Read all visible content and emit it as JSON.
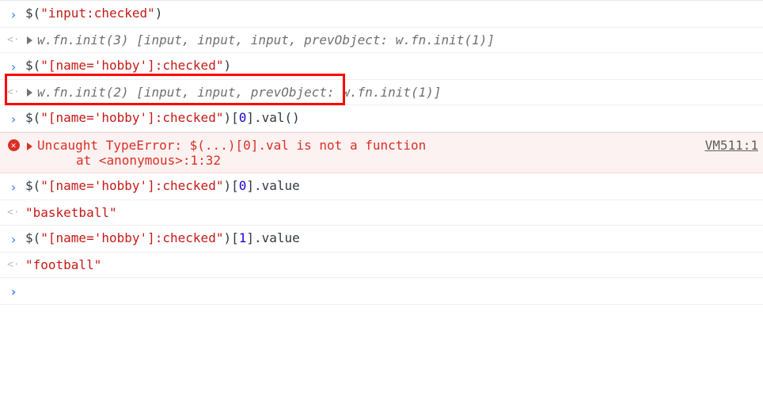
{
  "lines": [
    {
      "id": "l1",
      "type": "input",
      "code": "$(\"input:checked\")"
    },
    {
      "id": "l2",
      "type": "output-object",
      "text": "w.fn.init(3) [input, input, input, prevObject: w.fn.init(1)]"
    },
    {
      "id": "l3",
      "type": "input",
      "code": "$(\"[name='hobby']:checked\")"
    },
    {
      "id": "l4",
      "type": "output-object",
      "text": "w.fn.init(2) [input, input, prevObject: w.fn.init(1)]"
    },
    {
      "id": "l5",
      "type": "input",
      "code": "$(\"[name='hobby']:checked\")[0].val()"
    },
    {
      "id": "l6",
      "type": "error",
      "text": "Uncaught TypeError: $(...)[0].val is not a function",
      "trace": "at <anonymous>:1:32",
      "source": "VM511:1"
    },
    {
      "id": "l7",
      "type": "input",
      "code": "$(\"[name='hobby']:checked\")[0].value"
    },
    {
      "id": "l8",
      "type": "output-string",
      "text": "\"basketball\""
    },
    {
      "id": "l9",
      "type": "input",
      "code": "$(\"[name='hobby']:checked\")[1].value"
    },
    {
      "id": "l10",
      "type": "output-string",
      "text": "\"football\""
    },
    {
      "id": "l11",
      "type": "prompt-empty"
    }
  ],
  "highlight": {
    "targetLine": "l3"
  }
}
